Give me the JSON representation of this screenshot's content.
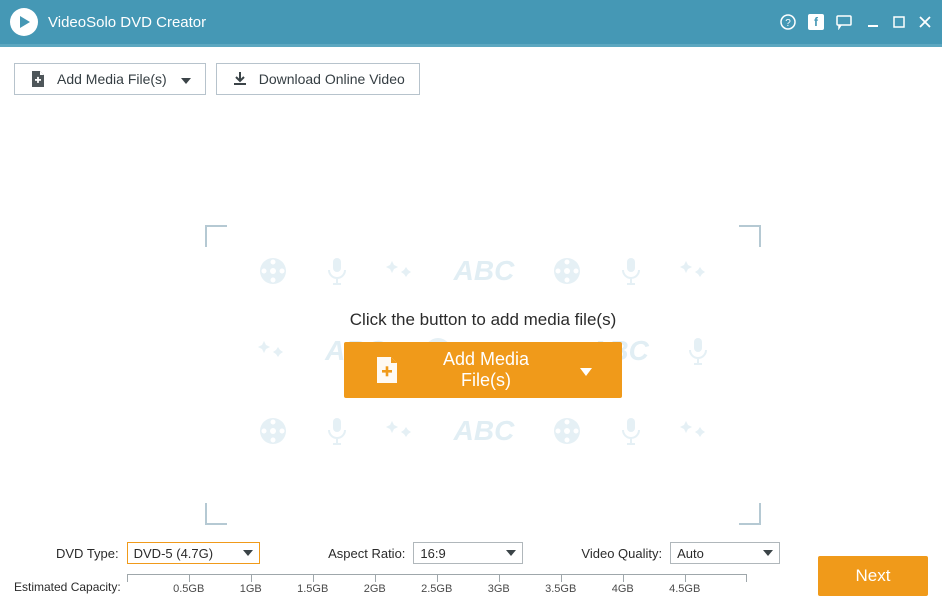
{
  "app": {
    "title": "VideoSolo DVD Creator"
  },
  "toolbar": {
    "add_media_label": "Add Media File(s)",
    "download_label": "Download Online Video"
  },
  "dropzone": {
    "instruction": "Click the button to add media file(s)",
    "add_button_label": "Add Media File(s)",
    "ghost_text": "ABC"
  },
  "bottom": {
    "dvd_type_label": "DVD Type:",
    "dvd_type_value": "DVD-5 (4.7G)",
    "aspect_label": "Aspect Ratio:",
    "aspect_value": "16:9",
    "quality_label": "Video Quality:",
    "quality_value": "Auto",
    "capacity_label": "Estimated Capacity:",
    "ticks": [
      "0.5GB",
      "1GB",
      "1.5GB",
      "2GB",
      "2.5GB",
      "3GB",
      "3.5GB",
      "4GB",
      "4.5GB"
    ],
    "next_label": "Next"
  }
}
